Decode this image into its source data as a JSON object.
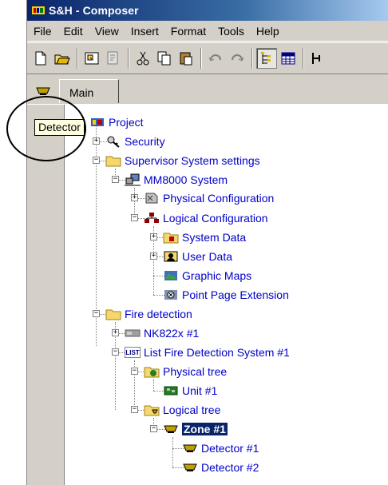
{
  "window": {
    "title": "S&H - Composer"
  },
  "menu": [
    "File",
    "Edit",
    "View",
    "Insert",
    "Format",
    "Tools",
    "Help"
  ],
  "toolbar": {
    "buttons": [
      "new-icon",
      "open-icon",
      "properties-icon",
      "preview-icon",
      "cut-icon",
      "copy-icon",
      "paste-icon",
      "undo-icon",
      "redo-icon",
      "tree-view-icon",
      "grid-view-icon",
      "split-icon"
    ]
  },
  "tabs": {
    "main_label": "Main"
  },
  "tooltip": {
    "text": "Detector"
  },
  "tree": {
    "project": "Project",
    "security": "Security",
    "supervisor": "Supervisor System settings",
    "mm8000": "MM8000 System",
    "physical_configuration": "Physical Configuration",
    "logical_configuration": "Logical Configuration",
    "system_data": "System Data",
    "user_data": "User Data",
    "graphic_maps": "Graphic Maps",
    "point_page_extension": "Point Page Extension",
    "fire_detection": "Fire detection",
    "nk822x": "NK822x #1",
    "list_fire": "List Fire Detection System #1",
    "list_badge": "LIST",
    "physical_tree": "Physical tree",
    "unit1": "Unit #1",
    "logical_tree": "Logical tree",
    "zone1": "Zone #1",
    "detector1": "Detector #1",
    "detector2": "Detector #2"
  },
  "colors": {
    "titlebar": "#0a246a",
    "tree_text": "#0000c8",
    "selection": "#0a246a",
    "tooltip_bg": "#ffffe1"
  }
}
